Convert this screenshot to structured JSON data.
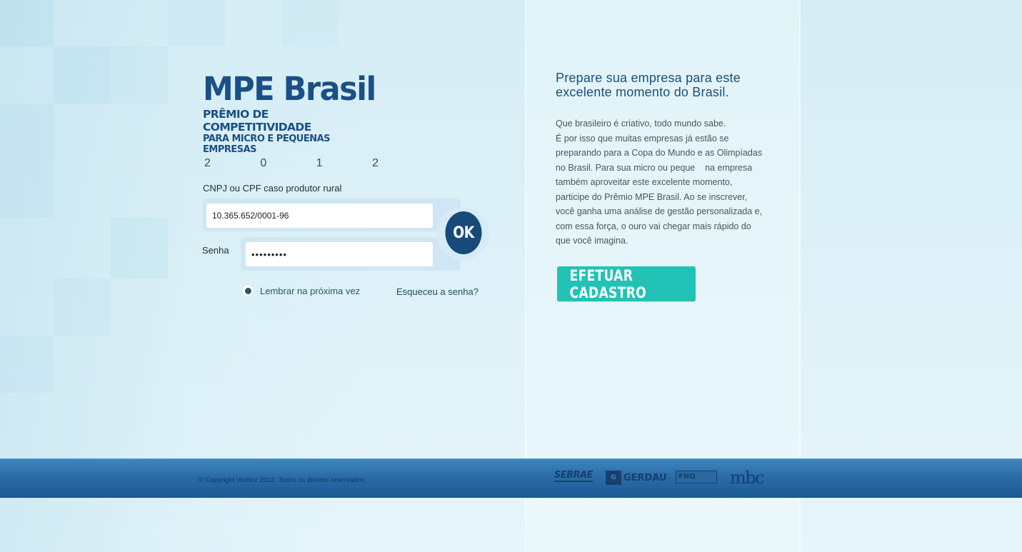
{
  "logo": {
    "title": "MPE Brasil",
    "subtitle_line1": "PRÊMIO DE COMPETITIVIDADE",
    "subtitle_line2": "PARA MICRO E PEQUENAS EMPRESAS",
    "year_digits": [
      "2",
      "0",
      "1",
      "2"
    ]
  },
  "login": {
    "cnpj_label": "CNPJ ou CPF caso produtor rural",
    "cnpj_value": "10.365.652/0001-96",
    "password_label": "Senha",
    "password_value": "•••••••••",
    "ok_label": "OK",
    "remember_label": "Lembrar na próxima vez",
    "remember_checked": true,
    "forgot_label": "Esqueceu a senha?"
  },
  "promo": {
    "headline": "Prepare sua empresa para este excelente momento do Brasil.",
    "body_lines": [
      "Que brasileiro é criativo, todo mundo sabe.",
      "É por isso que muitas empresas já estão se",
      "preparando para a Copa do Mundo e as Olimpíadas",
      "no Brasil. Para sua micro ou peque    na empresa",
      "também aproveitar este excelente momento,",
      "participe do Prêmio MPE Brasil. Ao se inscrever,",
      "você ganha uma análise de gestão personalizada e,",
      "com essa força, o ouro vai chegar mais rápido do",
      "que você imagina."
    ],
    "cta_label": "EFETUAR CADASTRO"
  },
  "footer": {
    "copyright": "© Copyright Vorttex 2012. Todos os direitos reservados.",
    "sponsors": {
      "sebrae": "SEBRAE",
      "gerdau_mark": "G",
      "gerdau": "GERDAU",
      "fnq": "FNQ",
      "mbc": "mbc"
    }
  },
  "colors": {
    "brand_blue": "#1b4f86",
    "ok_button": "#174a78",
    "cta_teal": "#22c2b6",
    "footer_blue": "#2a6ca8"
  }
}
